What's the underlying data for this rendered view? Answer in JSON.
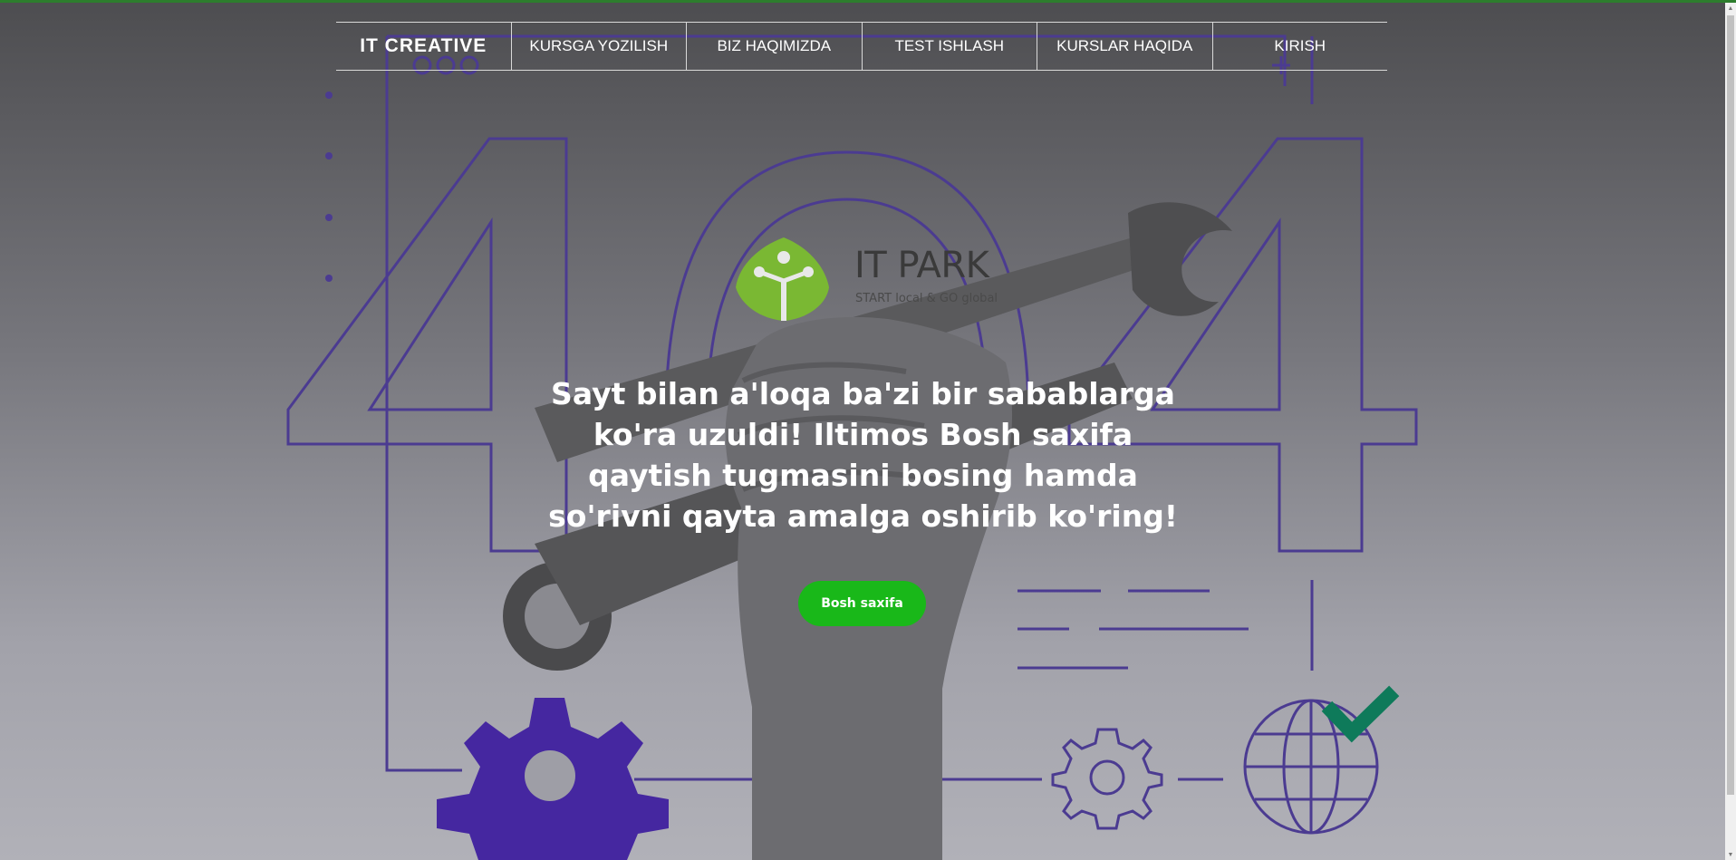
{
  "nav": {
    "brand": "IT CREATIVE",
    "items": [
      {
        "label": "KURSGA YOZILISH"
      },
      {
        "label": "BIZ HAQIMIZDA"
      },
      {
        "label": "TEST ISHLASH"
      },
      {
        "label": "KURSLAR HAQIDA"
      },
      {
        "label": "KIRISH"
      }
    ]
  },
  "logo": {
    "title": "IT PARK",
    "subtitle": "START local & GO global"
  },
  "message": "Sayt bilan a'loqa ba'zi bir sabablarga ko'ra uzuldi! Iltimos Bosh saxifa qaytish tugmasini bosing hamda so'rivni qayta amalga oshirib ko'ring!",
  "home_button": "Bosh saxifa",
  "colors": {
    "accent_green": "#19b819",
    "logo_green": "#7ab833",
    "line_purple": "#4b3b91",
    "gear_purple": "#4527a0",
    "check_teal": "#0e7a5a"
  },
  "icons": [
    "gear-icon",
    "globe-icon",
    "check-icon",
    "wrench-icon",
    "hand-icon"
  ]
}
